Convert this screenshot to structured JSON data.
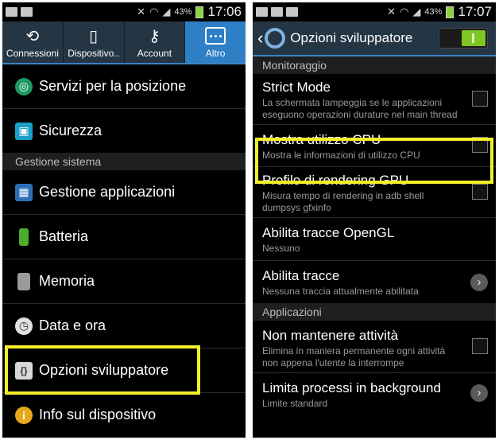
{
  "left": {
    "status": {
      "battery": "43%",
      "time": "17:06"
    },
    "tabs": [
      {
        "label": "Connessioni",
        "icon": "connections-icon"
      },
      {
        "label": "Dispositivo..",
        "icon": "device-icon"
      },
      {
        "label": "Account",
        "icon": "key-icon"
      },
      {
        "label": "Altro",
        "icon": "more-icon",
        "active": true
      }
    ],
    "items_top": [
      {
        "label": "Servizi per la posizione",
        "icon": "location-icon"
      },
      {
        "label": "Sicurezza",
        "icon": "lock-icon"
      }
    ],
    "section": "Gestione sistema",
    "items_bottom": [
      {
        "label": "Gestione applicazioni",
        "icon": "apps-grid-icon"
      },
      {
        "label": "Batteria",
        "icon": "battery-icon"
      },
      {
        "label": "Memoria",
        "icon": "sd-card-icon"
      },
      {
        "label": "Data e ora",
        "icon": "clock-icon"
      },
      {
        "label": "Opzioni sviluppatore",
        "icon": "braces-icon"
      },
      {
        "label": "Info sul dispositivo",
        "icon": "info-icon"
      }
    ]
  },
  "right": {
    "status": {
      "battery": "43%",
      "time": "17:07"
    },
    "title": "Opzioni sviluppatore",
    "section1": "Monitoraggio",
    "items1": [
      {
        "title": "Strict Mode",
        "sub": "La schermata lampeggia se le applicazioni eseguono operazioni durature nel main thread",
        "control": "checkbox"
      },
      {
        "title": "Mostra utilizzo CPU",
        "sub": "Mostra le informazioni di utilizzo CPU",
        "control": "checkbox"
      },
      {
        "title": "Profilo di rendering GPU",
        "sub": "Misura tempo di rendering in adb shell dumpsys gfxinfo",
        "control": "checkbox"
      },
      {
        "title": "Abilita tracce OpenGL",
        "sub": "Nessuno",
        "control": "none"
      },
      {
        "title": "Abilita tracce",
        "sub": "Nessuna traccia attualmente abilitata",
        "control": "chevron"
      }
    ],
    "section2": "Applicazioni",
    "items2": [
      {
        "title": "Non mantenere attività",
        "sub": "Elimina in maniera permanente ogni attività non appena l'utente la interrompe",
        "control": "checkbox"
      },
      {
        "title": "Limita processi in background",
        "sub": "Limite standard",
        "control": "chevron"
      }
    ]
  },
  "colors": {
    "highlight": "#f2ef2a",
    "accent": "#2f7fc7",
    "switch_on": "#7dc623"
  }
}
